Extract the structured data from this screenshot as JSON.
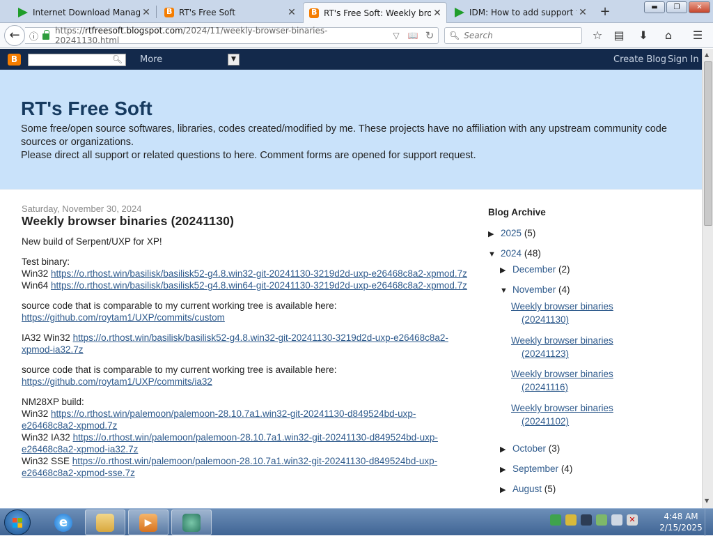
{
  "browser": {
    "tabs": [
      {
        "label": "Internet Download Manager",
        "icon": "idm-play-icon",
        "active": false
      },
      {
        "label": "RT's Free Soft",
        "icon": "blogger-icon",
        "active": false
      },
      {
        "label": "RT's Free Soft: Weekly brows",
        "icon": "blogger-icon",
        "active": true
      },
      {
        "label": "IDM: How to add support fo",
        "icon": "idm-play-icon",
        "active": false
      }
    ],
    "new_tab": "+",
    "url_host": "rtfreesoft.blogspot.com",
    "url_prefix": "https://",
    "url_path": "/2024/11/weekly-browser-binaries-20241130.html",
    "search_placeholder": "Search"
  },
  "blogger_nav": {
    "more": "More",
    "create_blog": "Create Blog",
    "sign_in": "Sign In"
  },
  "header": {
    "title": "RT's Free Soft",
    "description_line1": "Some free/open source softwares, libraries, codes created/modified by me. These projects have no affiliation with any upstream community code sources or organizations.",
    "description_line2": "Please direct all support or related questions to here. Comment forms are opened for support request."
  },
  "post": {
    "date": "Saturday, November 30, 2024",
    "title": "Weekly browser binaries (20241130)",
    "intro": "New build of Serpent/UXP for XP!",
    "test_binary_label": "Test binary:",
    "win32_label": "Win32",
    "win32_link": "https://o.rthost.win/basilisk/basilisk52-g4.8.win32-git-20241130-3219d2d-uxp-e26468c8a2-xpmod.7z",
    "win64_label": "Win64",
    "win64_link": "https://o.rthost.win/basilisk/basilisk52-g4.8.win64-git-20241130-3219d2d-uxp-e26468c8a2-xpmod.7z",
    "source_text": "source code that is comparable to my current working tree is available here:",
    "source_link1": "https://github.com/roytam1/UXP/commits/custom",
    "ia32_label": "IA32 Win32",
    "ia32_link": "https://o.rthost.win/basilisk/basilisk52-g4.8.win32-git-20241130-3219d2d-uxp-e26468c8a2-xpmod-ia32.7z",
    "source_link2": "https://github.com/roytam1/UXP/commits/ia32",
    "nm28_label": "NM28XP build:",
    "nm_win32_label": "Win32",
    "nm_win32_link": "https://o.rthost.win/palemoon/palemoon-28.10.7a1.win32-git-20241130-d849524bd-uxp-e26468c8a2-xpmod.7z",
    "nm_ia32_label": "Win32 IA32",
    "nm_ia32_link": "https://o.rthost.win/palemoon/palemoon-28.10.7a1.win32-git-20241130-d849524bd-uxp-e26468c8a2-xpmod-ia32.7z",
    "nm_sse_label": "Win32 SSE",
    "nm_sse_link": "https://o.rthost.win/palemoon/palemoon-28.10.7a1.win32-git-20241130-d849524bd-uxp-e26468c8a2-xpmod-sse.7z"
  },
  "sidebar": {
    "heading": "Blog Archive",
    "archive": [
      {
        "label": "2025",
        "count": "(5)",
        "expanded": false
      },
      {
        "label": "2024",
        "count": "(48)",
        "expanded": true
      },
      {
        "label": "December",
        "count": "(2)",
        "expanded": false
      },
      {
        "label": "November",
        "count": "(4)",
        "expanded": true
      },
      {
        "label": "October",
        "count": "(3)",
        "expanded": false
      },
      {
        "label": "September",
        "count": "(4)",
        "expanded": false
      },
      {
        "label": "August",
        "count": "(5)",
        "expanded": false
      }
    ],
    "posts": [
      {
        "line1": "Weekly browser binaries",
        "line2": "(20241130)"
      },
      {
        "line1": "Weekly browser binaries",
        "line2": "(20241123)"
      },
      {
        "line1": "Weekly browser binaries",
        "line2": "(20241116)"
      },
      {
        "line1": "Weekly browser binaries",
        "line2": "(20241102)"
      }
    ]
  },
  "taskbar": {
    "time": "4:48 AM",
    "date": "2/15/2025"
  },
  "colors": {
    "accent": "#2e5a8c",
    "header_bg": "#c9e2fa",
    "blogger_orange": "#f57d00",
    "nav_dark": "#13294b"
  }
}
